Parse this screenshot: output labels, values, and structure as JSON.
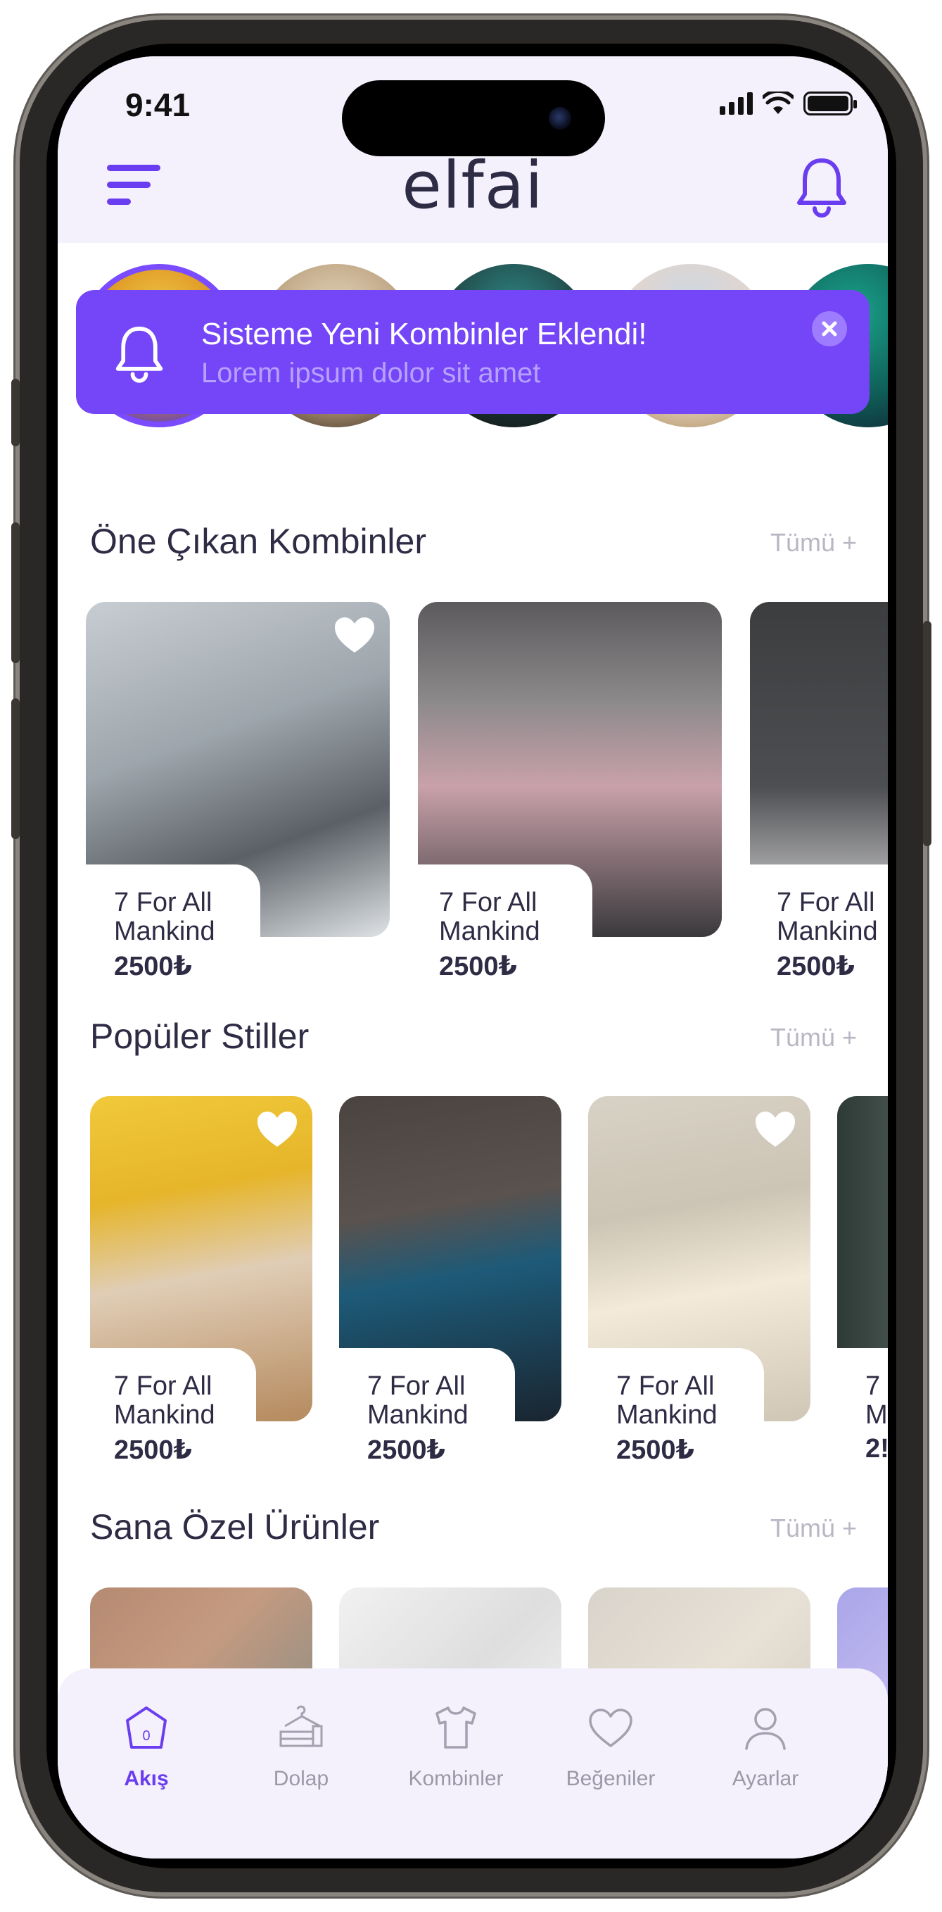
{
  "status_bar": {
    "time": "9:41"
  },
  "header": {
    "logo": "elfai"
  },
  "notification": {
    "title": "Sisteme Yeni Kombinler Eklendi!",
    "subtitle": "Lorem ipsum dolor sit amet"
  },
  "sections": [
    {
      "title": "Öne Çıkan Kombinler",
      "see_all": "Tümü +",
      "cards": [
        {
          "brand": "7 For All Mankind",
          "brand_line1": "7 For All",
          "brand_line2": "Mankind",
          "price": "2500₺"
        },
        {
          "brand": "7 For All Mankind",
          "brand_line1": "7 For All",
          "brand_line2": "Mankind",
          "price": "2500₺"
        },
        {
          "brand": "7 For All Mankind",
          "brand_line1": "7 For All",
          "brand_line2": "Mankind",
          "price": "2500₺"
        }
      ]
    },
    {
      "title": "Popüler Stiller",
      "see_all": "Tümü +",
      "cards": [
        {
          "brand_line1": "7 For All",
          "brand_line2": "Mankind",
          "price": "2500₺"
        },
        {
          "brand_line1": "7 For All",
          "brand_line2": "Mankind",
          "price": "2500₺"
        },
        {
          "brand_line1": "7 For All",
          "brand_line2": "Mankind",
          "price": "2500₺"
        },
        {
          "brand_line1": "7",
          "brand_line2": "M",
          "price": "2!"
        }
      ]
    },
    {
      "title": "Sana Özel Ürünler",
      "see_all": "Tümü +"
    }
  ],
  "tab_bar": {
    "tabs": [
      {
        "label": "Akış",
        "icon": "home-icon",
        "active": true,
        "badge": "0"
      },
      {
        "label": "Dolap",
        "icon": "wardrobe-icon",
        "active": false
      },
      {
        "label": "Kombinler",
        "icon": "shirt-icon",
        "active": false
      },
      {
        "label": "Beğeniler",
        "icon": "heart-icon",
        "active": false
      },
      {
        "label": "Ayarlar",
        "icon": "user-icon",
        "active": false
      }
    ]
  },
  "colors": {
    "accent": "#6b3df0",
    "banner": "#7446f8",
    "header_bg": "#f4f1fc",
    "text": "#2e2c45"
  }
}
